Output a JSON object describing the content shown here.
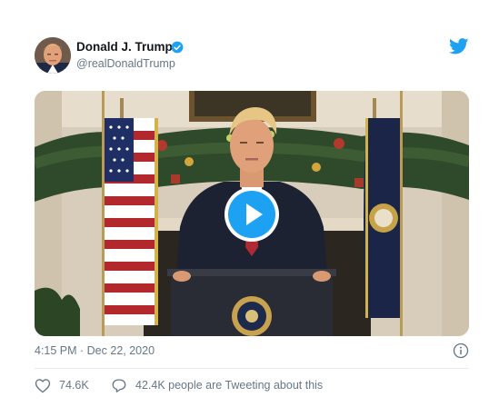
{
  "author": {
    "display_name": "Donald J. Trump",
    "handle": "@realDonaldTrump",
    "verified": true
  },
  "icons": {
    "avatar": "profile-photo",
    "verified": "verified-badge-icon",
    "brand": "twitter-bird-icon",
    "media_control": "play-icon",
    "info": "info-icon",
    "like": "heart-icon",
    "reply": "speech-bubble-icon"
  },
  "tweet": {
    "timestamp": "4:15 PM · Dec 22, 2020",
    "likes": "74.6K",
    "tweeting_text": "42.4K people are Tweeting about this"
  },
  "colors": {
    "accent": "#1da1f2",
    "text_primary": "#14171a",
    "text_secondary": "#657786",
    "divider": "#e6ecf0"
  }
}
